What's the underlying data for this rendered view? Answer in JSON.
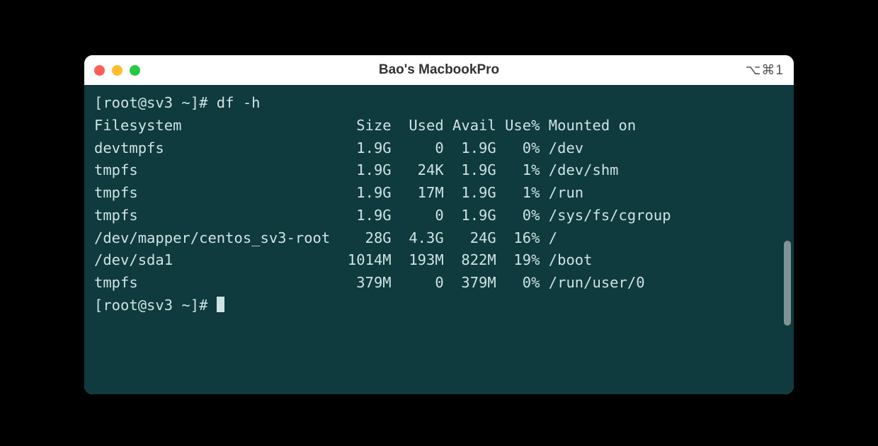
{
  "window": {
    "title": "Bao's MacbookPro",
    "shortcut": "⌥⌘1"
  },
  "terminal": {
    "prompt1": "[root@sv3 ~]# df -h",
    "prompt2": "[root@sv3 ~]# ",
    "header": {
      "filesystem": "Filesystem",
      "size": "Size",
      "used": "Used",
      "avail": "Avail",
      "usep": "Use%",
      "mounted": "Mounted on"
    },
    "rows": [
      {
        "fs": "devtmpfs",
        "size": "1.9G",
        "used": "0",
        "avail": "1.9G",
        "usep": "0%",
        "mount": "/dev"
      },
      {
        "fs": "tmpfs",
        "size": "1.9G",
        "used": "24K",
        "avail": "1.9G",
        "usep": "1%",
        "mount": "/dev/shm"
      },
      {
        "fs": "tmpfs",
        "size": "1.9G",
        "used": "17M",
        "avail": "1.9G",
        "usep": "1%",
        "mount": "/run"
      },
      {
        "fs": "tmpfs",
        "size": "1.9G",
        "used": "0",
        "avail": "1.9G",
        "usep": "0%",
        "mount": "/sys/fs/cgroup"
      },
      {
        "fs": "/dev/mapper/centos_sv3-root",
        "size": "28G",
        "used": "4.3G",
        "avail": "24G",
        "usep": "16%",
        "mount": "/"
      },
      {
        "fs": "/dev/sda1",
        "size": "1014M",
        "used": "193M",
        "avail": "822M",
        "usep": "19%",
        "mount": "/boot"
      },
      {
        "fs": "tmpfs",
        "size": "379M",
        "used": "0",
        "avail": "379M",
        "usep": "0%",
        "mount": "/run/user/0"
      }
    ]
  }
}
